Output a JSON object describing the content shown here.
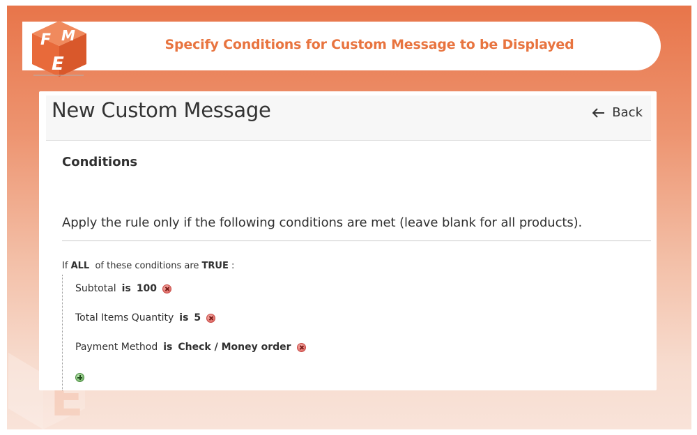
{
  "banner": {
    "title": "Specify Conditions for Custom Message to be Displayed",
    "logo_icon": "fme-logo-icon",
    "accent_color": "#e8743f"
  },
  "header": {
    "page_title": "New Custom Message",
    "back_label": "Back",
    "back_icon": "arrow-left-icon"
  },
  "conditions": {
    "section_title": "Conditions",
    "rule_heading": "Apply the rule only if the following conditions are met (leave blank for all products).",
    "if_prefix": "If",
    "aggregator": "ALL",
    "middle_text": "of these conditions are",
    "value": "TRUE",
    "suffix": ":",
    "items": [
      {
        "attribute": "Subtotal",
        "operator": "is",
        "value": "100"
      },
      {
        "attribute": "Total Items Quantity",
        "operator": "is",
        "value": "5"
      },
      {
        "attribute": "Payment Method",
        "operator": "is",
        "value": "Check / Money order"
      }
    ],
    "add_icon": "add-condition-icon",
    "remove_icon": "remove-condition-icon"
  }
}
